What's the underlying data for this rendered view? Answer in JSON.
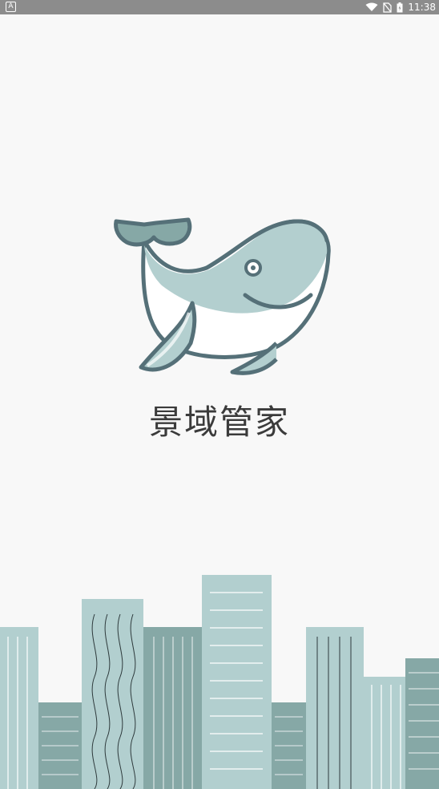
{
  "status_bar": {
    "notification_letter": "A",
    "time": "11:38",
    "icons": [
      "wifi-icon",
      "no-sim-icon",
      "battery-icon"
    ]
  },
  "splash": {
    "app_name": "景域管家",
    "logo": "whale-logo",
    "illustration": "city-skyline"
  },
  "colors": {
    "background": "#f8f8f8",
    "status_bar": "#8c8c8c",
    "whale_fill": "#b3cfcf",
    "whale_outline": "#557078",
    "building_light": "#b2cfcf",
    "building_dark": "#86a8a6"
  }
}
